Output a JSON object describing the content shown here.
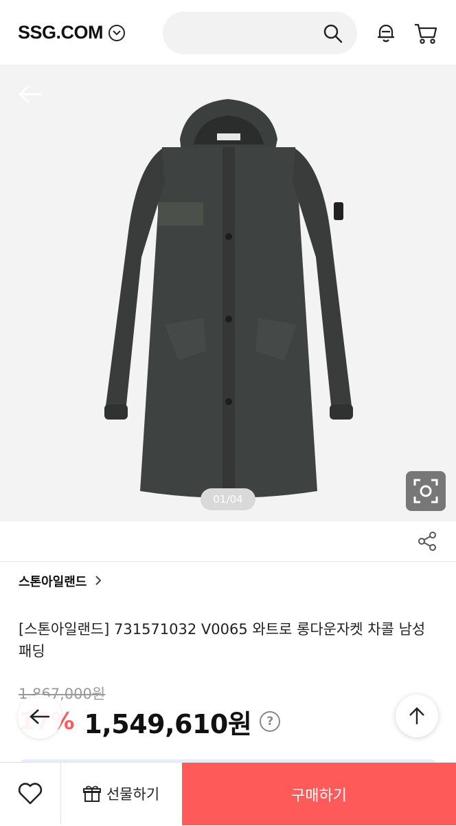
{
  "header": {
    "logo": "SSG.COM",
    "search_placeholder": ""
  },
  "gallery": {
    "counter": "01/04"
  },
  "product": {
    "brand": "스톤아일랜드",
    "title": "[스톤아일랜드] 731571032 V0065 와트로 롱다운자켓 차콜 남성 패딩",
    "original_price": "1,867,000원",
    "discount": "17%",
    "price": "1,549,610원",
    "help_symbol": "?"
  },
  "bottom_bar": {
    "gift_label": "선물하기",
    "buy_label": "구매하기"
  },
  "colors": {
    "accent": "#ff5a5a",
    "hero_bg": "#f3f3f3"
  }
}
